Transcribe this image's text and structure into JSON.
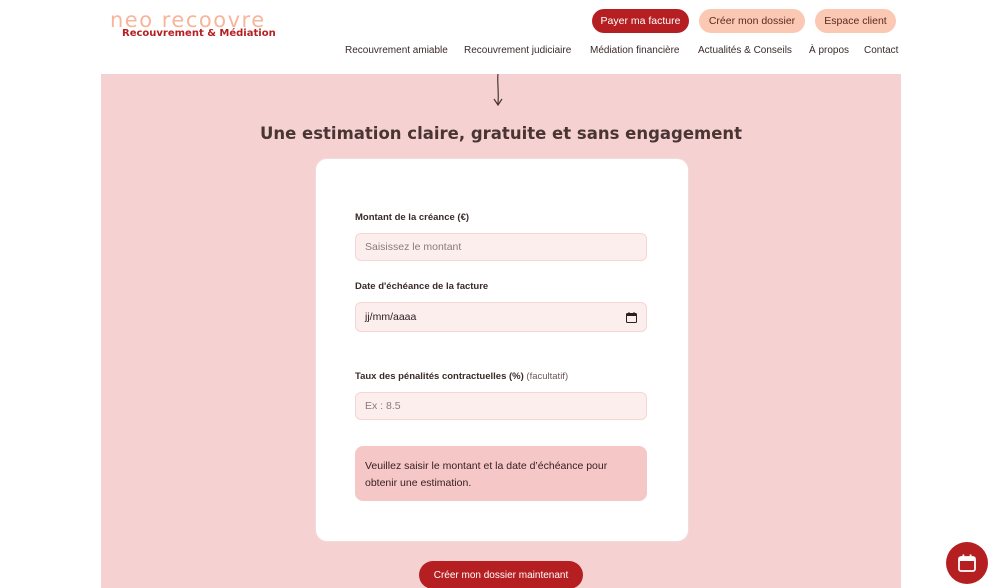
{
  "brand": {
    "name": "neo recoovre",
    "tagline": "Recouvrement & Médiation"
  },
  "header_buttons": {
    "pay": "Payer ma facture",
    "create": "Créer mon dossier",
    "client": "Espace client"
  },
  "nav": [
    "Recouvrement amiable",
    "Recouvrement judiciaire",
    "Médiation financière",
    "Actualités & Conseils",
    "À propos",
    "Contact"
  ],
  "main": {
    "headline": "Une estimation claire, gratuite et sans engagement"
  },
  "form": {
    "amount_label": "Montant de la créance (€)",
    "amount_placeholder": "Saisissez le montant",
    "date_label": "Date d'échéance de la facture",
    "date_placeholder": "jj/mm/aaaa",
    "penalty_label": "Taux des pénalités contractuelles (%)",
    "penalty_optional": "(facultatif)",
    "penalty_placeholder": "Ex : 8.5",
    "notice": "Veuillez saisir le montant et la date d’échéance pour obtenir une estimation."
  },
  "cta": "Créer mon dossier maintenant",
  "colors": {
    "brand_red": "#b61f22",
    "peach": "#fbc8b3",
    "section_pink": "#f6d1d1",
    "notice_pink": "#f5c7c7"
  },
  "icons": {
    "arrow": "arrow-down-icon",
    "calendar": "calendar-icon",
    "fab": "calendar-fab-icon"
  }
}
